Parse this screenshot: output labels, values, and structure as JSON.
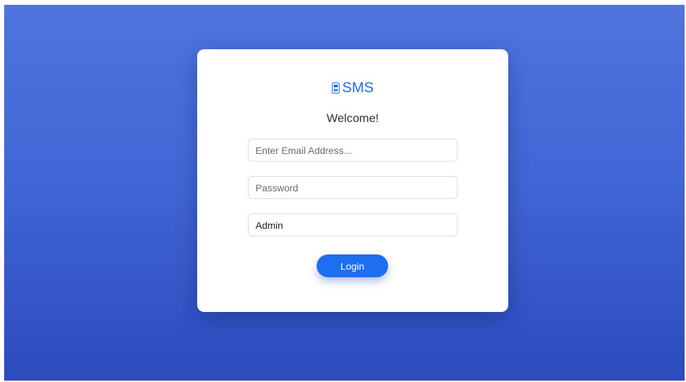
{
  "brand": {
    "name": "SMS",
    "icon": "id-card-icon",
    "color": "#1e6fe6"
  },
  "login_form": {
    "welcome": "Welcome!",
    "email": {
      "placeholder": "Enter Email Address...",
      "value": ""
    },
    "password": {
      "placeholder": "Password",
      "value": ""
    },
    "role": {
      "value": "Admin"
    },
    "submit_label": "Login"
  },
  "colors": {
    "background_top": "#4f74dd",
    "background_bottom": "#2c4bbd",
    "button": "#1e6ff0"
  }
}
